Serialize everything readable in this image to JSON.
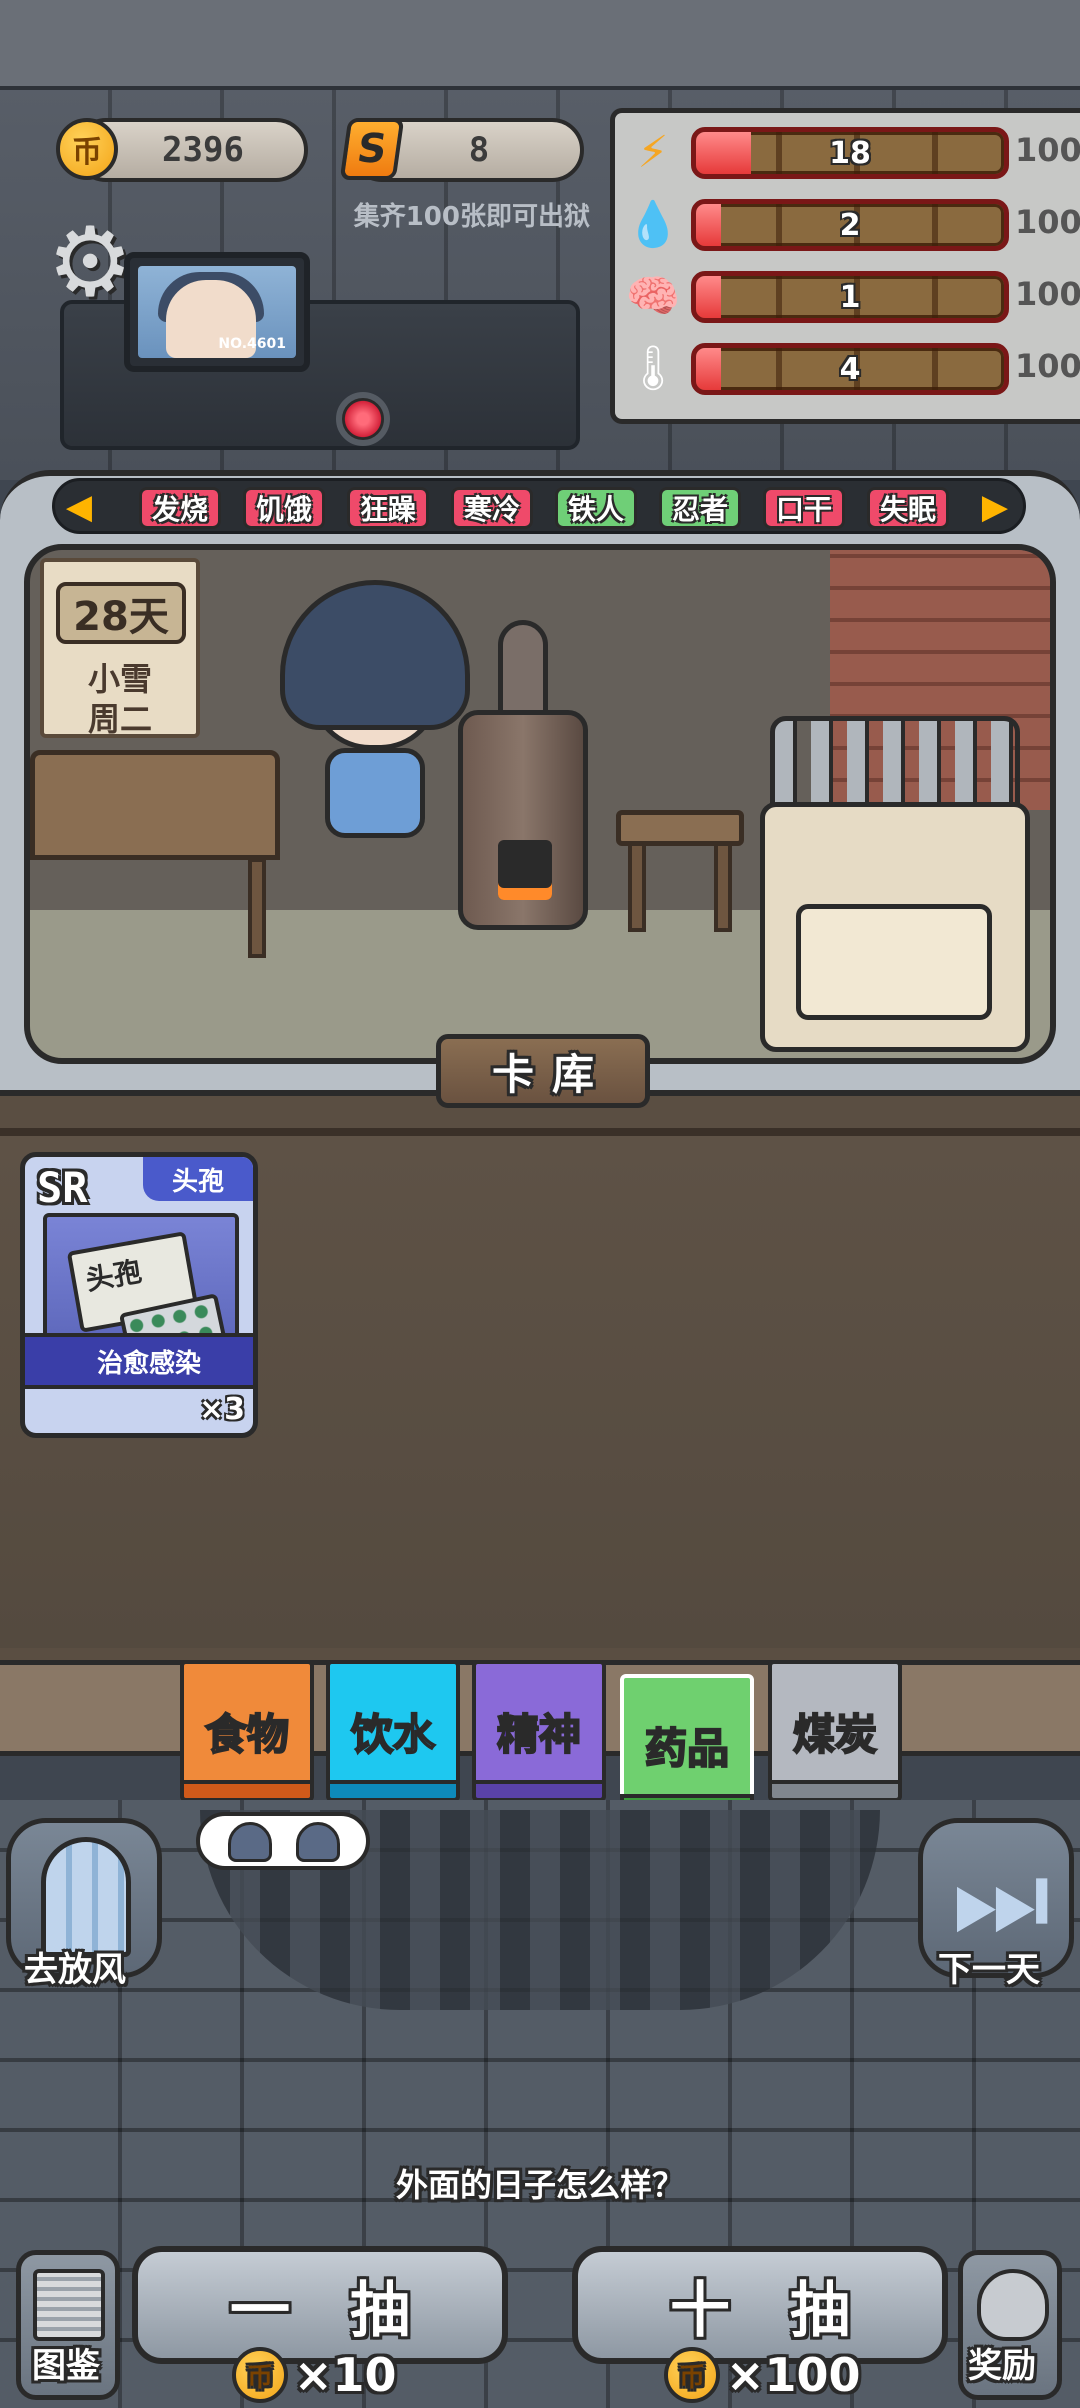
{
  "hud": {
    "coins": "2396",
    "coin_symbol": "币",
    "cards": "8",
    "card_symbol": "S",
    "hint": "集齐100张即可出狱",
    "monitor_no": "NO.4601",
    "settings_icon": "gear-icon"
  },
  "stats": [
    {
      "icon": "energy-icon",
      "glyph": "⚡",
      "value": "18",
      "level": 0.18,
      "max": "100"
    },
    {
      "icon": "water-drop-icon",
      "glyph": "💧",
      "value": "2",
      "level": 0.02,
      "max": "100"
    },
    {
      "icon": "brain-icon",
      "glyph": "🧠",
      "value": "1",
      "level": 0.01,
      "max": "100"
    },
    {
      "icon": "thermometer-icon",
      "glyph": "🌡",
      "value": "4",
      "level": 0.04,
      "max": "100"
    }
  ],
  "status_tags": [
    {
      "label": "发烧",
      "color": "#ef4a6a"
    },
    {
      "label": "饥饿",
      "color": "#ef4a6a"
    },
    {
      "label": "狂躁",
      "color": "#ef4a6a"
    },
    {
      "label": "寒冷",
      "color": "#ef4a6a"
    },
    {
      "label": "铁人",
      "color": "#6fcf77"
    },
    {
      "label": "忍者",
      "color": "#6fcf77"
    },
    {
      "label": "口干",
      "color": "#ef4a6a"
    },
    {
      "label": "失眠",
      "color": "#ef4a6a"
    }
  ],
  "calendar": {
    "days": "28天",
    "weather": "小雪",
    "weekday": "周二"
  },
  "card_storage": {
    "title": "卡库",
    "cards": [
      {
        "rarity": "SR",
        "kind": "头孢",
        "art_label": "头孢",
        "name": "治愈感染",
        "count": "×3"
      }
    ]
  },
  "categories": [
    {
      "label": "食物",
      "color": "#f08a3a",
      "base": "#d05a1a",
      "text": "#c0501a"
    },
    {
      "label": "饮水",
      "color": "#1ec8f0",
      "base": "#0e8aba",
      "text": "#0e7aa8"
    },
    {
      "label": "精神",
      "color": "#8a6ad8",
      "base": "#5a42a8",
      "text": "#5a3aa8"
    },
    {
      "label": "药品",
      "color": "#6fd06f",
      "base": "#3a9a3a",
      "text": "#2e8a2e"
    },
    {
      "label": "煤炭",
      "color": "#b4b8c0",
      "base": "#80868e",
      "text": "#50545a"
    }
  ],
  "actions": {
    "go_out": "去放风",
    "next_day": "下一天",
    "dialog": "外面的日子怎么样？",
    "draw_one": "一抽",
    "draw_one_cost": "×10",
    "draw_ten": "十抽",
    "draw_ten_cost": "×100",
    "collection": "图鉴",
    "rewards": "奖励"
  }
}
